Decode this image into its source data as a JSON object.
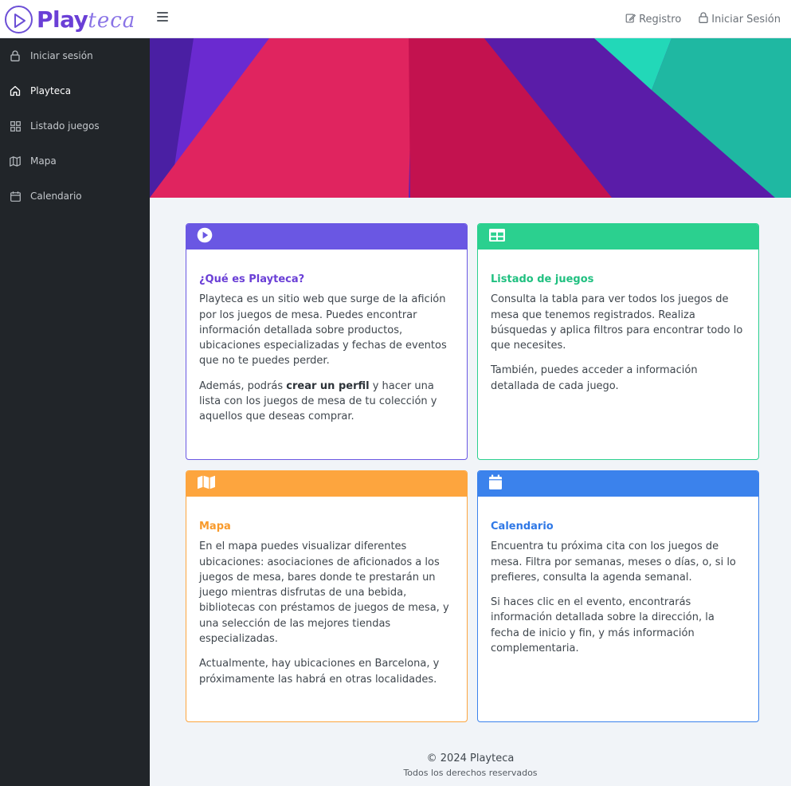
{
  "app": {
    "logo_main": "Play",
    "logo_thin": "teca"
  },
  "header": {
    "links": [
      {
        "label": "Registro",
        "icon": "edit-icon"
      },
      {
        "label": "Iniciar Sesión",
        "icon": "lock-icon"
      }
    ]
  },
  "sidebar": {
    "items": [
      {
        "label": "Iniciar sesión",
        "icon": "lock-icon",
        "active": false
      },
      {
        "label": "Playteca",
        "icon": "home-icon",
        "active": true
      },
      {
        "label": "Listado juegos",
        "icon": "grid-icon",
        "active": false
      },
      {
        "label": "Mapa",
        "icon": "map-icon",
        "active": false
      },
      {
        "label": "Calendario",
        "icon": "calendar-icon",
        "active": false
      }
    ]
  },
  "cards": {
    "about": {
      "icon": "play-circle-icon",
      "color": "#6a57e3",
      "title": "¿Qué es Playteca?",
      "p1": "Playteca es un sitio web que surge de la afición por los juegos de mesa. Puedes encontrar información detallada sobre productos, ubicaciones especializadas y fechas de eventos que no te puedes perder.",
      "p2_before": "Además, podrás ",
      "p2_bold": "crear un perfil",
      "p2_after": " y hacer una lista con los juegos de mesa de tu colección y aquellos que deseas comprar."
    },
    "games": {
      "icon": "table-icon",
      "color": "#2bd08f",
      "title": "Listado de juegos",
      "p1": "Consulta la tabla para ver todos los juegos de mesa que tenemos registrados. Realiza búsquedas y aplica filtros para encontrar todo lo que necesites.",
      "p2": "También, puedes acceder a información detallada de cada juego."
    },
    "map": {
      "icon": "map-icon",
      "color": "#fda53e",
      "title": "Mapa",
      "p1": "En el mapa puedes visualizar diferentes ubicaciones: asociaciones de aficionados a los juegos de mesa, bares donde te prestarán un juego mientras disfrutas de una bebida, bibliotecas con préstamos de juegos de mesa, y una selección de las mejores tiendas especializadas.",
      "p2": "Actualmente, hay ubicaciones en Barcelona, y próximamente las habrá en otras localidades."
    },
    "calendar": {
      "icon": "calendar-icon",
      "color": "#3b82ec",
      "title": "Calendario",
      "p1": "Encuentra tu próxima cita con los juegos de mesa. Filtra por semanas, meses o días, o, si lo prefieres, consulta la agenda semanal.",
      "p2": "Si haces clic en el evento, encontrarás información detallada sobre la dirección, la fecha de inicio y fin, y más información complementaria."
    }
  },
  "footer": {
    "copyright": "© 2024 Playteca",
    "rights": "Todos los derechos reservados"
  }
}
